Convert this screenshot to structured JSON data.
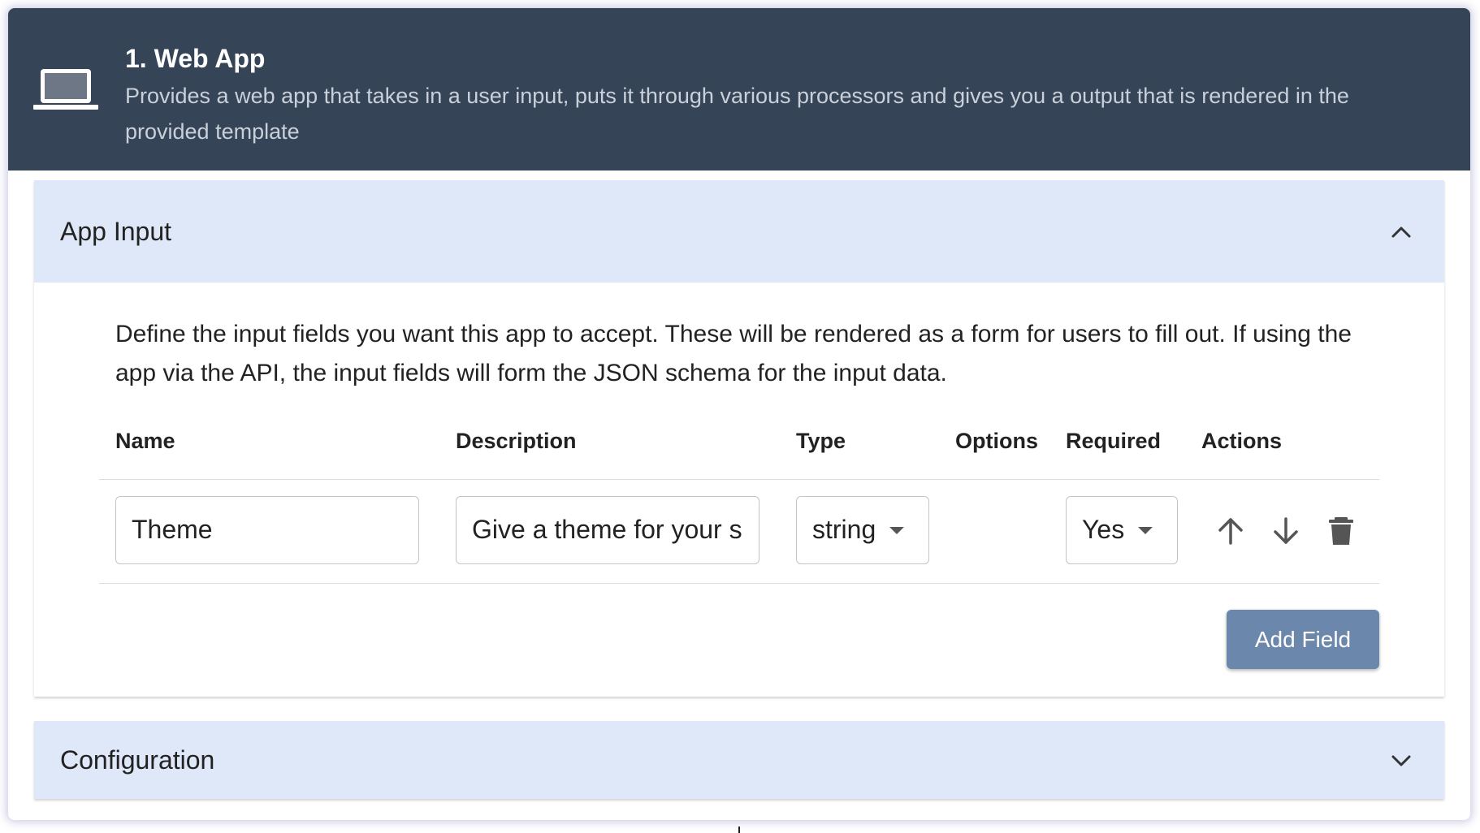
{
  "header": {
    "icon": "laptop-icon",
    "title": "1. Web App",
    "description": "Provides a web app that takes in a user input, puts it through various processors and gives you a output that is rendered in the provided template"
  },
  "app_input": {
    "title": "App Input",
    "expanded": true,
    "intro": "Define the input fields you want this app to accept. These will be rendered as a form for users to fill out. If using the app via the API, the input fields will form the JSON schema for the input data.",
    "columns": [
      "Name",
      "Description",
      "Type",
      "Options",
      "Required",
      "Actions"
    ],
    "rows": [
      {
        "name": "Theme",
        "description": "Give a theme for your s",
        "type": "string",
        "required": "Yes"
      }
    ],
    "add_field_label": "Add Field"
  },
  "configuration": {
    "title": "Configuration",
    "expanded": false
  },
  "colors": {
    "header_bg": "#354457",
    "panel_head_bg": "#dfe8f8",
    "button_bg": "#6b87ab"
  }
}
